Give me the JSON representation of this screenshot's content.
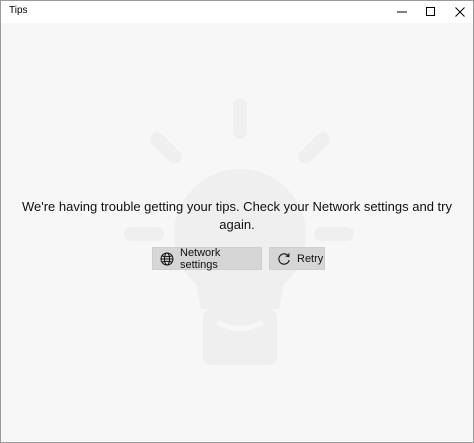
{
  "window": {
    "title": "Tips"
  },
  "main": {
    "message": "We're having trouble getting your tips. Check your Network settings and try again."
  },
  "buttons": {
    "network_settings_label": "Network settings",
    "retry_label": "Retry"
  },
  "icons": {
    "background": "lightbulb-icon",
    "network": "globe-icon",
    "retry": "refresh-icon",
    "minimize": "minimize-icon",
    "maximize": "maximize-icon",
    "close": "close-icon"
  }
}
